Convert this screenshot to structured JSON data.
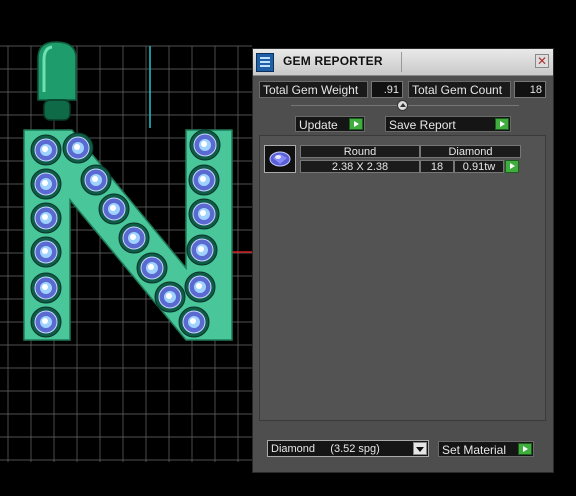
{
  "window": {
    "title": "GEM REPORTER",
    "close_glyph": "✕"
  },
  "stats": {
    "weight_label": "Total Gem Weight",
    "weight_value": ".91",
    "count_label": "Total Gem Count",
    "count_value": "18"
  },
  "buttons": {
    "update": "Update",
    "save_report": "Save Report",
    "set_material": "Set Material"
  },
  "report_table": {
    "shape_header": "Round",
    "material_header": "Diamond",
    "size": "2.38 X 2.38",
    "count": "18",
    "weight": "0.91tw"
  },
  "material_select": {
    "value": "Diamond     (3.52 spg)"
  },
  "colors": {
    "metal": "#49c79a",
    "gem": "#9fd2ff",
    "panel_bg": "#4e4e4e",
    "accent_green": "#3fae3f",
    "grid": "#6a6a6a"
  },
  "icons": {
    "title_icon": "report-icon",
    "close": "close-icon",
    "play": "play-arrow-icon",
    "dropdown": "chevron-down-icon",
    "gem_thumb": "round-diamond-icon"
  }
}
